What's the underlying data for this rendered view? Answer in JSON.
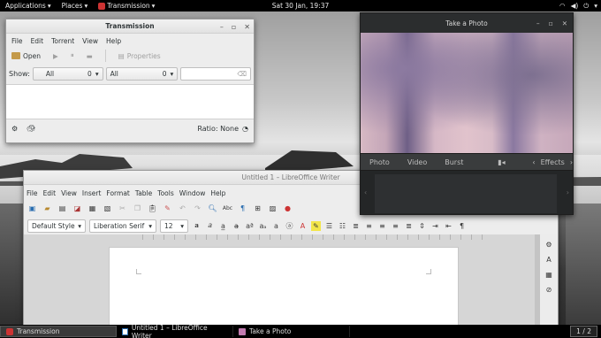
{
  "topbar": {
    "applications": "Applications",
    "places": "Places",
    "active_app": "Transmission",
    "clock": "Sat 30 Jan, 19:37"
  },
  "transmission": {
    "title": "Transmission",
    "menu": [
      "File",
      "Edit",
      "Torrent",
      "View",
      "Help"
    ],
    "toolbar": {
      "open": "Open",
      "properties": "Properties"
    },
    "filter": {
      "show_label": "Show:",
      "filter1": "All",
      "filter1_count": "0",
      "filter2": "All",
      "filter2_count": "0",
      "search_placeholder": ""
    },
    "status": {
      "ratio": "Ratio: None"
    }
  },
  "photo": {
    "title": "Take a Photo",
    "modes": [
      "Photo",
      "Video",
      "Burst"
    ],
    "effects": "Effects"
  },
  "writer": {
    "title": "Untitled 1 – LibreOffice Writer",
    "menu": [
      "File",
      "Edit",
      "View",
      "Insert",
      "Format",
      "Table",
      "Tools",
      "Window",
      "Help"
    ],
    "style": "Default Style",
    "font": "Liberation Serif",
    "size": "12"
  },
  "taskbar": {
    "items": [
      "Transmission",
      "Untitled 1 – LibreOffice Writer",
      "Take a Photo"
    ],
    "pager": "1 / 2"
  },
  "colors": {
    "panel": "#000000",
    "window_bg": "#ededed",
    "dark_panel": "#2d2f30"
  }
}
